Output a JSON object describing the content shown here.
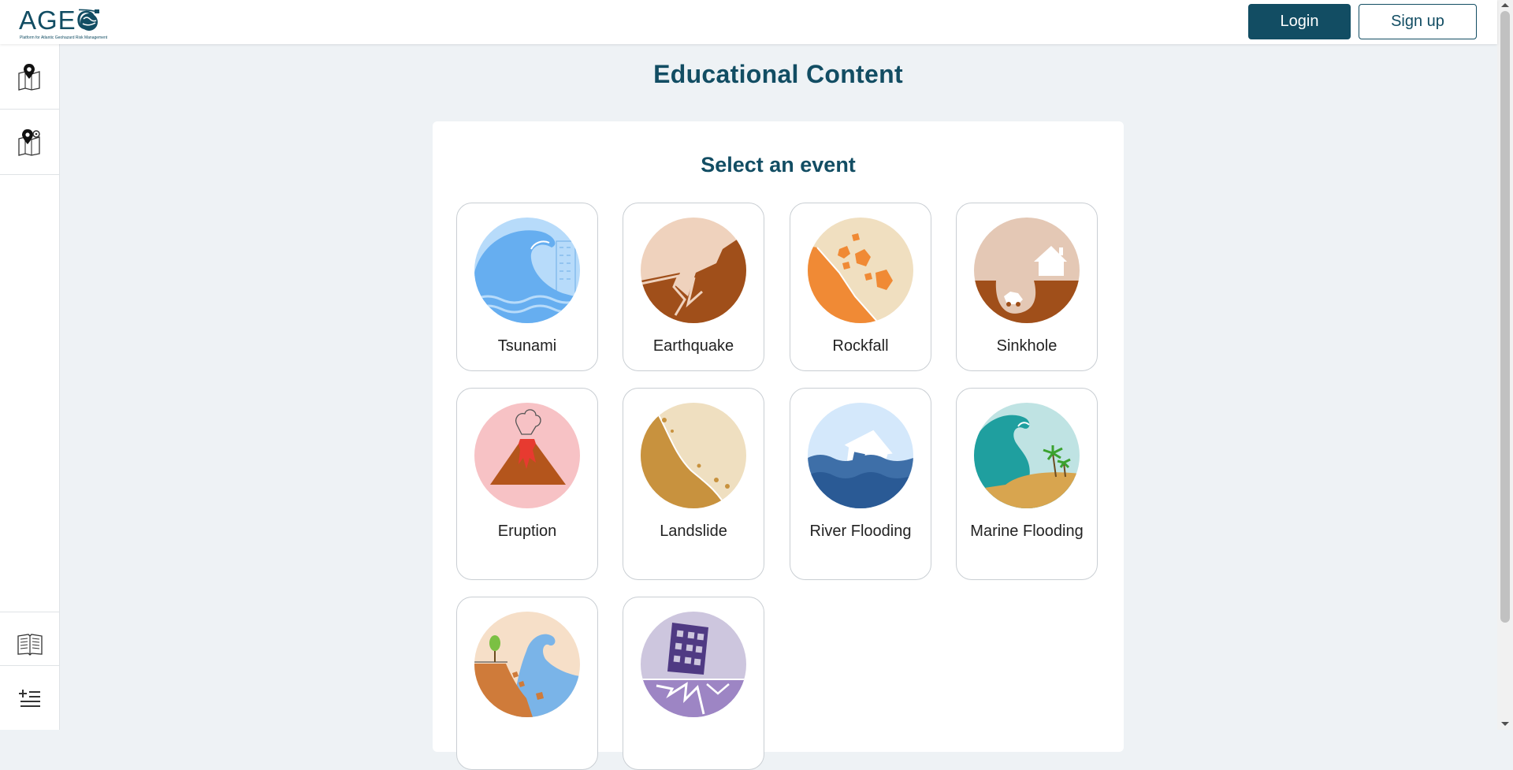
{
  "header": {
    "logo_text": "AGEO",
    "logo_subtitle": "Platform for Atlantic Geohazard Risk Management",
    "login_label": "Login",
    "signup_label": "Sign up"
  },
  "sidebar": {
    "items": [
      {
        "icon": "map-pin-icon"
      },
      {
        "icon": "map-settings-icon"
      }
    ],
    "bottom_items": [
      {
        "icon": "book-icon"
      },
      {
        "icon": "add-list-icon"
      }
    ]
  },
  "main": {
    "title": "Educational Content",
    "panel_title": "Select an event",
    "events": [
      {
        "label": "Tsunami",
        "icon": "tsunami-icon"
      },
      {
        "label": "Earthquake",
        "icon": "earthquake-icon"
      },
      {
        "label": "Rockfall",
        "icon": "rockfall-icon"
      },
      {
        "label": "Sinkhole",
        "icon": "sinkhole-icon"
      },
      {
        "label": "Eruption",
        "icon": "eruption-icon"
      },
      {
        "label": "Landslide",
        "icon": "landslide-icon"
      },
      {
        "label": "River Flooding",
        "icon": "river-flooding-icon"
      },
      {
        "label": "Marine Flooding",
        "icon": "marine-flooding-icon"
      },
      {
        "label": "",
        "icon": "coastal-erosion-icon"
      },
      {
        "label": "",
        "icon": "building-collapse-icon"
      }
    ]
  },
  "colors": {
    "brand": "#124d63",
    "background": "#eef2f5",
    "card_border": "#c9ced3"
  }
}
